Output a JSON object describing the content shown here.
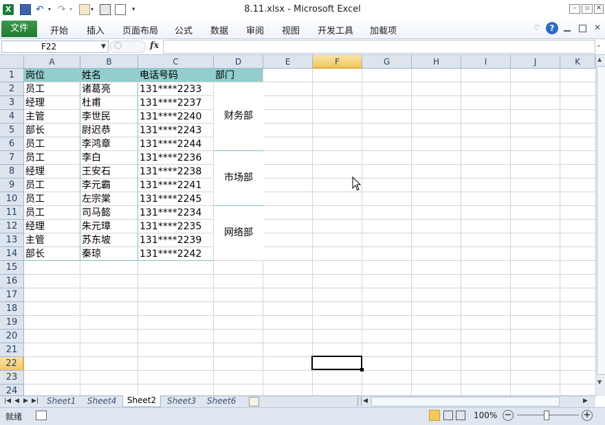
{
  "window": {
    "title": "8.11.xlsx  -  Microsoft Excel"
  },
  "ribbon": {
    "tabs": [
      "文件",
      "开始",
      "插入",
      "页面布局",
      "公式",
      "数据",
      "审阅",
      "视图",
      "开发工具",
      "加载项"
    ]
  },
  "formula_bar": {
    "name_box": "F22",
    "fx_label": "fx",
    "content": ""
  },
  "columns": [
    "A",
    "B",
    "C",
    "D",
    "E",
    "F",
    "G",
    "H",
    "I",
    "J",
    "K"
  ],
  "rows": [
    "1",
    "2",
    "3",
    "4",
    "5",
    "6",
    "7",
    "8",
    "9",
    "10",
    "11",
    "12",
    "13",
    "14",
    "15",
    "16",
    "17",
    "18",
    "19",
    "20",
    "21",
    "22",
    "23",
    "24"
  ],
  "table": {
    "headers": [
      "岗位",
      "姓名",
      "电话号码",
      "部门"
    ],
    "rows": [
      [
        "员工",
        "诸葛亮",
        "131****2233"
      ],
      [
        "经理",
        "杜甫",
        "131****2237"
      ],
      [
        "主管",
        "李世民",
        "131****2240"
      ],
      [
        "部长",
        "尉迟恭",
        "131****2243"
      ],
      [
        "员工",
        "李鸿章",
        "131****2244"
      ],
      [
        "员工",
        "李白",
        "131****2236"
      ],
      [
        "经理",
        "王安石",
        "131****2238"
      ],
      [
        "员工",
        "李元霸",
        "131****2241"
      ],
      [
        "员工",
        "左宗棠",
        "131****2245"
      ],
      [
        "员工",
        "司马懿",
        "131****2234"
      ],
      [
        "经理",
        "朱元璋",
        "131****2235"
      ],
      [
        "主管",
        "苏东坡",
        "131****2239"
      ],
      [
        "部长",
        "秦琼",
        "131****2242"
      ]
    ],
    "departments": [
      "财务部",
      "市场部",
      "网络部"
    ]
  },
  "sheets": [
    "Sheet1",
    "Sheet4",
    "Sheet2",
    "Sheet3",
    "Sheet6"
  ],
  "active_sheet": "Sheet2",
  "status": {
    "mode": "就绪",
    "zoom": "100%"
  },
  "colors": {
    "header_fill": "#93cdcd",
    "active_col_header": "#f7d57a",
    "file_tab": "#2a8a3c",
    "row_hdr_bg": "#dde4ee"
  }
}
